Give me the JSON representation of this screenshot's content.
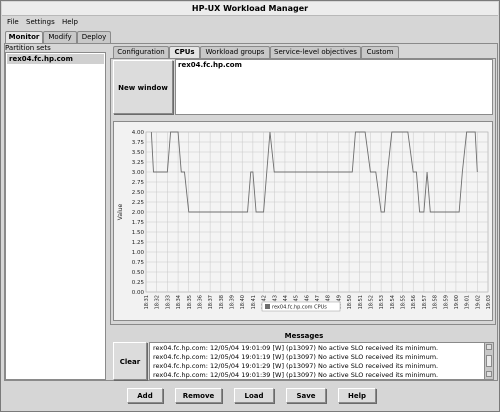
{
  "window": {
    "title": "HP-UX Workload Manager"
  },
  "menu": [
    "File",
    "Settings",
    "Help"
  ],
  "outer_tabs": [
    "Monitor",
    "Modify",
    "Deploy"
  ],
  "left_panel": {
    "label": "Partition sets",
    "items": [
      "rex04.fc.hp.com"
    ]
  },
  "inner_tabs": [
    "Configuration",
    "CPUs",
    "Workload groups",
    "Service-level objectives",
    "Custom"
  ],
  "new_window_label": "New window",
  "host_list": [
    "rex04.fc.hp.com"
  ],
  "chart_data": {
    "type": "line",
    "ylabel": "Value",
    "ylim": [
      0,
      4
    ],
    "yticks": [
      "0.00",
      "0.25",
      "0.50",
      "0.75",
      "1.00",
      "1.25",
      "1.50",
      "1.75",
      "2.00",
      "2.25",
      "2.50",
      "2.75",
      "3.00",
      "3.25",
      "3.50",
      "3.75",
      "4.00"
    ],
    "xticks": [
      "18:31",
      "18:32",
      "18:33",
      "18:34",
      "18:35",
      "18:36",
      "18:37",
      "18:38",
      "18:39",
      "18:40",
      "18:41",
      "18:42",
      "18:43",
      "18:44",
      "18:45",
      "18:46",
      "18:47",
      "18:48",
      "18:49",
      "18:50",
      "18:51",
      "18:52",
      "18:53",
      "18:54",
      "18:55",
      "18:56",
      "18:57",
      "18:58",
      "18:59",
      "19:00",
      "19:01",
      "19:02",
      "19:03"
    ],
    "series": [
      {
        "name": "rex04.fc.hp.com CPUs",
        "color": "#6e6e6e",
        "x": [
          0.5,
          0.7,
          1.0,
          1.5,
          1.8,
          2.0,
          2.3,
          2.5,
          3.0,
          3.3,
          3.6,
          4.0,
          4.5,
          5.0,
          6.0,
          7.0,
          8.0,
          9.0,
          9.3,
          9.5,
          9.8,
          10.0,
          10.3,
          10.5,
          11.0,
          11.3,
          11.6,
          12.0,
          13.0,
          14.0,
          15.0,
          16.0,
          17.0,
          18.0,
          19.0,
          19.3,
          19.6,
          20.0,
          20.5,
          21.0,
          21.5,
          22.0,
          22.3,
          22.6,
          23.0,
          23.5,
          24.0,
          24.5,
          25.0,
          25.3,
          25.6,
          26.0,
          26.3,
          26.6,
          27.0,
          28.0,
          29.0,
          29.3,
          29.6,
          30.0,
          30.5,
          30.8,
          31.0
        ],
        "y": [
          4.0,
          3.0,
          3.0,
          3.0,
          3.0,
          3.0,
          4.0,
          4.0,
          4.0,
          3.0,
          3.0,
          2.0,
          2.0,
          2.0,
          2.0,
          2.0,
          2.0,
          2.0,
          2.0,
          2.0,
          3.0,
          3.0,
          2.0,
          2.0,
          2.0,
          3.0,
          4.0,
          3.0,
          3.0,
          3.0,
          3.0,
          3.0,
          3.0,
          3.0,
          3.0,
          3.0,
          4.0,
          4.0,
          4.0,
          3.0,
          3.0,
          2.0,
          2.0,
          3.0,
          4.0,
          4.0,
          4.0,
          4.0,
          3.0,
          3.0,
          2.0,
          2.0,
          3.0,
          2.0,
          2.0,
          2.0,
          2.0,
          2.0,
          3.0,
          4.0,
          4.0,
          4.0,
          3.0
        ]
      }
    ]
  },
  "messages": {
    "title": "Messages",
    "clear_label": "Clear",
    "lines": [
      "rex04.fc.hp.com: 12/05/04 19:01:09 [W] (p13097) No active SLO received its minimum.",
      "rex04.fc.hp.com: 12/05/04 19:01:19 [W] (p13097) No active SLO received its minimum.",
      "rex04.fc.hp.com: 12/05/04 19:01:29 [W] (p13097) No active SLO received its minimum.",
      "rex04.fc.hp.com: 12/05/04 19:01:39 [W] (p13097) No active SLO received its minimum."
    ]
  },
  "bottom_buttons": [
    "Add",
    "Remove",
    "Load",
    "Save",
    "Help"
  ]
}
